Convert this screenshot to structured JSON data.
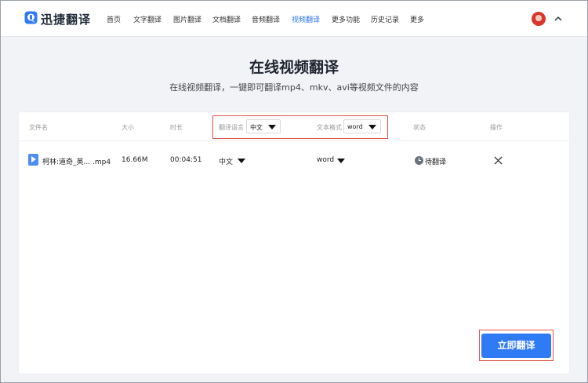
{
  "header": {
    "app_name": "迅捷翻译",
    "nav": [
      {
        "label": "首页",
        "active": false
      },
      {
        "label": "文字翻译",
        "active": false
      },
      {
        "label": "图片翻译",
        "active": false
      },
      {
        "label": "文档翻译",
        "active": false
      },
      {
        "label": "音频翻译",
        "active": false
      },
      {
        "label": "视频翻译",
        "active": true
      },
      {
        "label": "更多功能",
        "active": false
      },
      {
        "label": "历史记录",
        "active": false
      },
      {
        "label": "更多",
        "active": false
      }
    ]
  },
  "hero": {
    "title": "在线视频翻译",
    "subtitle": "在线视频翻译，一键即可翻译mp4、mkv、avi等视频文件的内容"
  },
  "table": {
    "headers": {
      "filename": "文件名",
      "size": "大小",
      "duration": "时长",
      "target_lang": "翻译语言",
      "format": "文本格式",
      "status": "状态",
      "actions": "操作"
    },
    "header_lang_value": "中文",
    "header_format_value": "word",
    "rows": [
      {
        "filename": "柯林:道奇_英... .mp4",
        "size": "16.66M",
        "duration": "00:04:51",
        "target_lang": "中文",
        "format": "word",
        "status": "待翻译"
      }
    ]
  },
  "actions": {
    "translate_now": "立即翻译"
  },
  "colors": {
    "accent": "#2f7bf5",
    "nav_active": "#2a74e8",
    "highlight_border": "#e0534a",
    "background": "#f1f3f7"
  },
  "icons": [
    "app-logo-icon",
    "avatar",
    "chevron-up-icon",
    "video-file-icon",
    "dropdown-caret-icon",
    "clock-icon",
    "close-icon"
  ]
}
